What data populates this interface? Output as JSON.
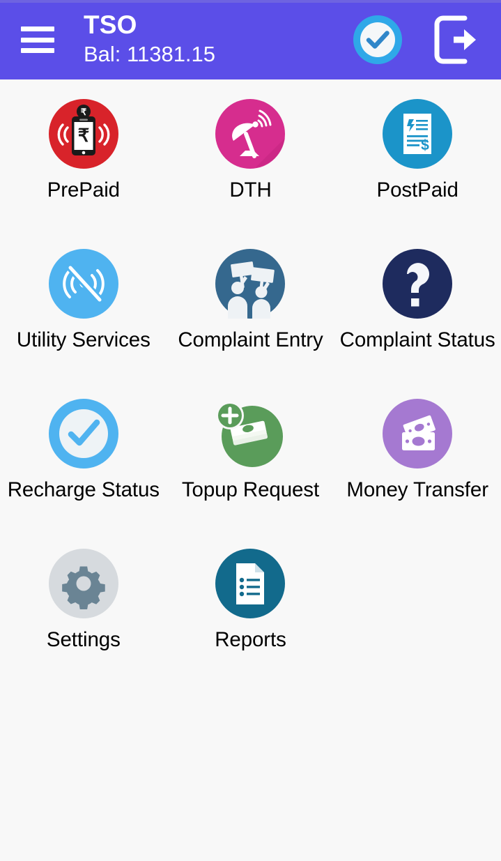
{
  "header": {
    "menu_icon": "hamburger-menu-icon",
    "title": "TSO",
    "balance": "Bal: 11381.15",
    "verified_icon": "check-circle-icon",
    "logout_icon": "logout-icon",
    "background_color": "#5b4ee8",
    "text_color": "#ffffff"
  },
  "page": {
    "background_color": "#f8f8f8",
    "label_color": "#000000"
  },
  "grid": {
    "columns": 3,
    "tiles": [
      {
        "id": "prepaid",
        "label": "PrePaid",
        "icon": "mobile-rupee-recharge-icon",
        "color": "#d8232a"
      },
      {
        "id": "dth",
        "label": "DTH",
        "icon": "satellite-dish-icon",
        "color": "#d62d8e"
      },
      {
        "id": "postpaid",
        "label": "PostPaid",
        "icon": "bill-invoice-icon",
        "color": "#1b94c9"
      },
      {
        "id": "utility-services",
        "label": "Utility Services",
        "icon": "signal-off-icon",
        "color": "#4fb3f0"
      },
      {
        "id": "complaint-entry",
        "label": "Complaint Entry",
        "icon": "protest-placards-icon",
        "color": "#35688e"
      },
      {
        "id": "complaint-status",
        "label": "Complaint Status",
        "icon": "question-mark-icon",
        "color": "#1e2b5e"
      },
      {
        "id": "recharge-status",
        "label": "Recharge Status",
        "icon": "check-circle-outline-icon",
        "color": "#4fb3f0"
      },
      {
        "id": "topup-request",
        "label": "Topup Request",
        "icon": "money-plus-icon",
        "color": "#5a9c5a"
      },
      {
        "id": "money-transfer",
        "label": "Money Transfer",
        "icon": "banknotes-icon",
        "color": "#a579d1"
      },
      {
        "id": "settings",
        "label": "Settings",
        "icon": "gear-icon",
        "color": "#d6dade"
      },
      {
        "id": "reports",
        "label": "Reports",
        "icon": "document-list-icon",
        "color": "#126a8c"
      }
    ]
  }
}
